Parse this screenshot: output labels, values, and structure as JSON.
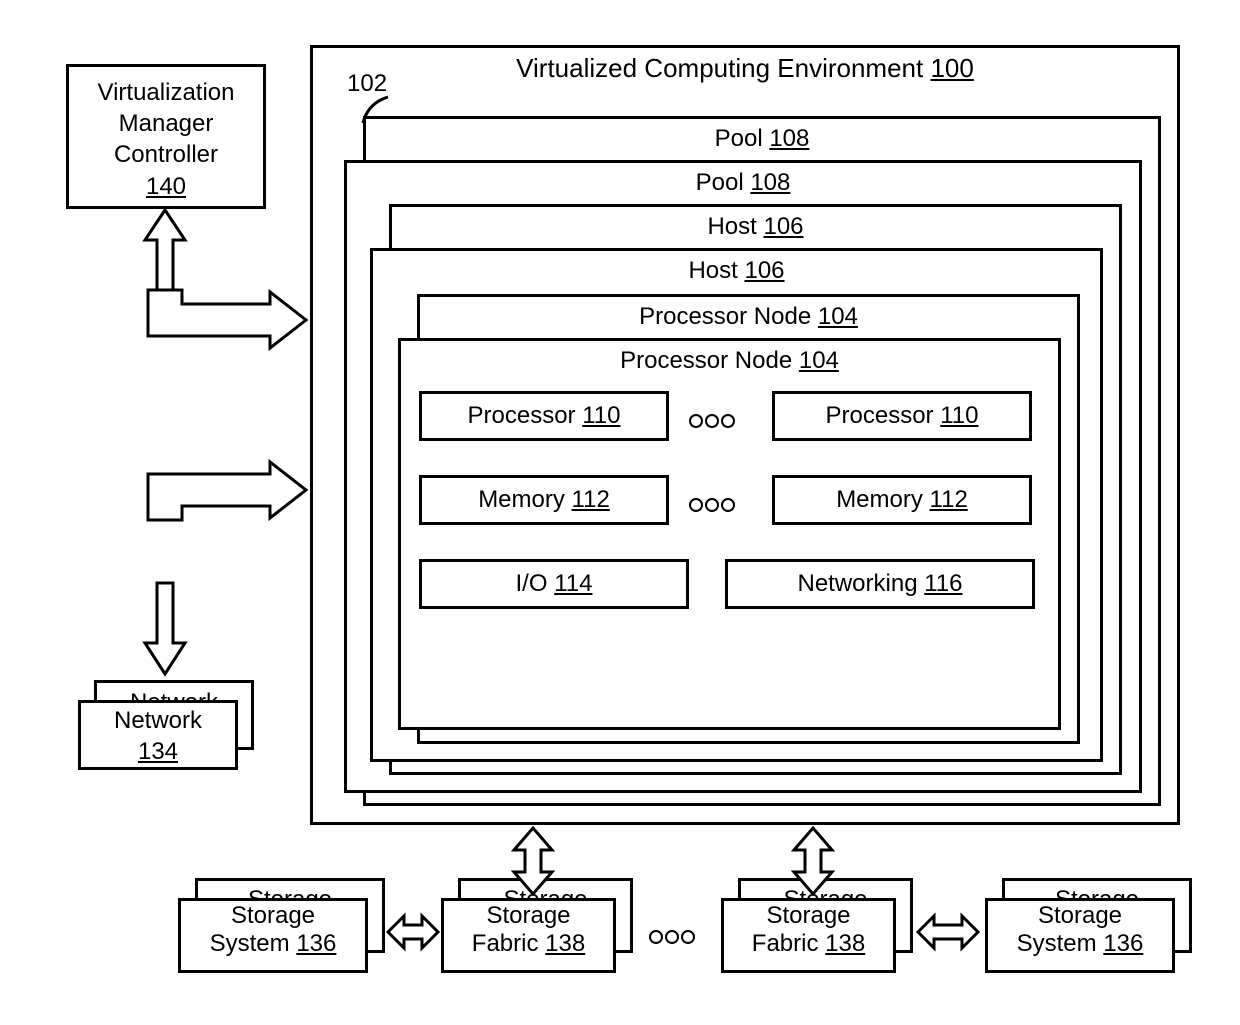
{
  "controller": {
    "label": "Virtualization\nManager\nController",
    "ref": "140"
  },
  "environment": {
    "label": "Virtualized Computing Environment",
    "ref": "100"
  },
  "callout_102": "102",
  "pool_back": {
    "label": "Pool",
    "ref": "108"
  },
  "pool_front": {
    "label": "Pool",
    "ref": "108"
  },
  "host_back": {
    "label": "Host",
    "ref": "106"
  },
  "host_front": {
    "label": "Host",
    "ref": "106"
  },
  "pnode_back": {
    "label": "Processor Node",
    "ref": "104"
  },
  "pnode_front": {
    "label": "Processor Node",
    "ref": "104"
  },
  "processor_left": {
    "label": "Processor",
    "ref": "110"
  },
  "processor_right": {
    "label": "Processor",
    "ref": "110"
  },
  "memory_left": {
    "label": "Memory",
    "ref": "112"
  },
  "memory_right": {
    "label": "Memory",
    "ref": "112"
  },
  "io": {
    "label": "I/O",
    "ref": "114"
  },
  "networking": {
    "label": "Networking",
    "ref": "116"
  },
  "network_back": {
    "label": "Network",
    "ref": "134"
  },
  "network_front": {
    "label": "Network",
    "ref": "134"
  },
  "storage_sys_left_back": {
    "label": "Storage",
    "ref": "136"
  },
  "storage_sys_left_front": {
    "label": "Storage\nSystem",
    "ref": "136"
  },
  "storage_fabric_left_back": {
    "label": "Storage",
    "ref": "138"
  },
  "storage_fabric_left_front": {
    "label": "Storage\nFabric",
    "ref": "138"
  },
  "storage_fabric_right_back": {
    "label": "Storage",
    "ref": "138"
  },
  "storage_fabric_right_front": {
    "label": "Storage\nFabric",
    "ref": "138"
  },
  "storage_sys_right_back": {
    "label": "Storage",
    "ref": "136"
  },
  "storage_sys_right_front": {
    "label": "Storage\nSystem",
    "ref": "136"
  }
}
